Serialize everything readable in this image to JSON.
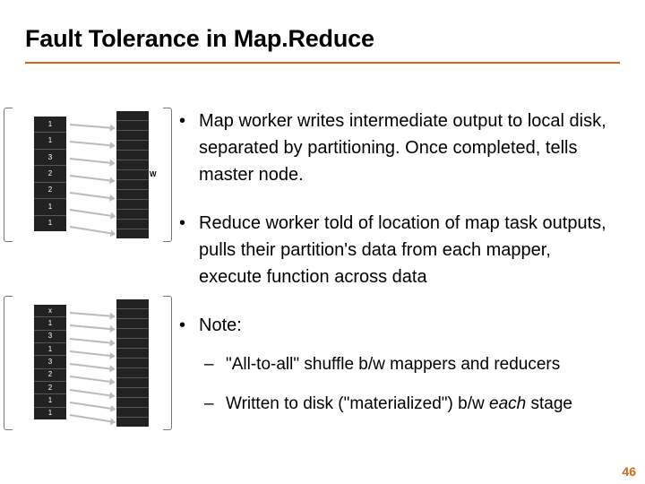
{
  "title": "Fault Tolerance in Map.Reduce",
  "bullets": [
    "Map worker writes intermediate output to local disk, separated by partitioning. Once completed, tells master node.",
    "Reduce worker told of location of map task outputs, pulls their partition's data from each mapper, execute function across data",
    "Note:"
  ],
  "subbullets": [
    "\"All-to-all\" shuffle b/w mappers and reducers",
    "Written to disk (\"materialized\") b/w "
  ],
  "sub_em": "each",
  "sub_tail": " stage",
  "page_number": "46",
  "diag": {
    "top_small": [
      "1",
      "1",
      "3",
      "2",
      "2",
      "1",
      "1"
    ],
    "bot_small": [
      "x",
      "1",
      "3",
      "1",
      "3",
      "2",
      "2",
      "1",
      "1"
    ],
    "tall_rows": 13,
    "w_label": "W"
  }
}
